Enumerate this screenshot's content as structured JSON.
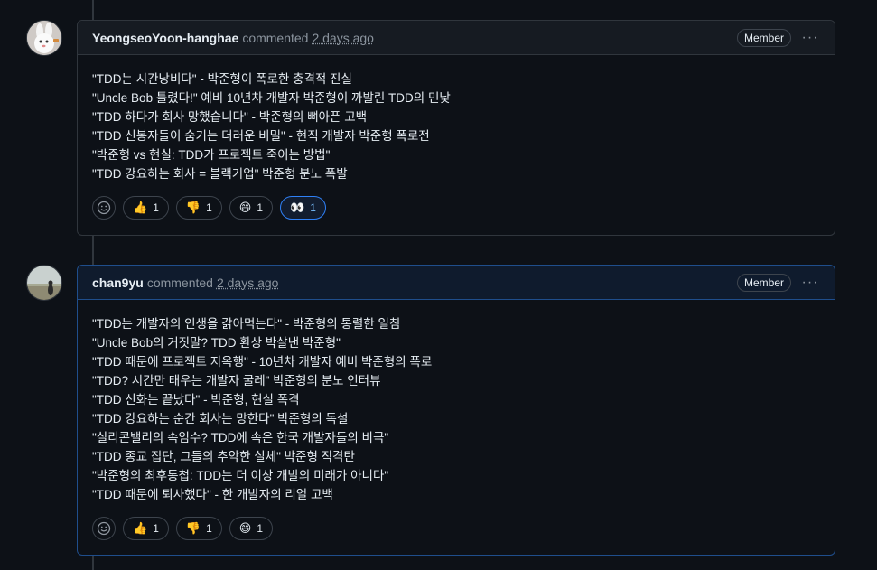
{
  "comments": [
    {
      "author": "YeongseoYoon-hanghae",
      "verb": "commented",
      "time": "2 days ago",
      "badge": "Member",
      "lines": [
        "\"TDD는 시간낭비다\" - 박준형이 폭로한 충격적 진실",
        "\"Uncle Bob 틀렸다!\" 예비 10년차 개발자 박준형이 까발린 TDD의 민낯",
        "\"TDD 하다가 회사 망했습니다\" - 박준형의 뼈아픈 고백",
        "\"TDD 신봉자들이 숨기는 더러운 비밀\" - 현직 개발자 박준형 폭로전",
        "\"박준형 vs 현실: TDD가 프로젝트 죽이는 방법\"",
        "\"TDD 강요하는 회사 = 블랙기업\" 박준형 분노 폭발"
      ],
      "reactions": [
        {
          "icon": "thumbs-up-icon",
          "emoji": "👍",
          "count": "1"
        },
        {
          "icon": "thumbs-down-icon",
          "emoji": "👎",
          "count": "1"
        },
        {
          "icon": "laugh-icon",
          "emoji": "😄",
          "count": "1"
        },
        {
          "icon": "eyes-icon",
          "emoji": "👀",
          "count": "1"
        }
      ]
    },
    {
      "author": "chan9yu",
      "verb": "commented",
      "time": "2 days ago",
      "badge": "Member",
      "lines": [
        "\"TDD는 개발자의 인생을 갉아먹는다\" - 박준형의 통렬한 일침",
        "\"Uncle Bob의 거짓말? TDD 환상 박살낸 박준형\"",
        "\"TDD 때문에 프로젝트 지옥행\" - 10년차 개발자 예비 박준형의 폭로",
        "\"TDD? 시간만 태우는 개발자 굴레\" 박준형의 분노 인터뷰",
        "\"TDD 신화는 끝났다\" - 박준형, 현실 폭격",
        "\"TDD 강요하는 순간 회사는 망한다\" 박준형의 독설",
        "\"실리콘밸리의 속임수? TDD에 속은 한국 개발자들의 비극\"",
        "\"TDD 종교 집단, 그들의 추악한 실체\" 박준형 직격탄",
        "\"박준형의 최후통첩: TDD는 더 이상 개발의 미래가 아니다\"",
        "\"TDD 때문에 퇴사했다\" - 한 개발자의 리얼 고백"
      ],
      "reactions": [
        {
          "icon": "thumbs-up-icon",
          "emoji": "👍",
          "count": "1"
        },
        {
          "icon": "thumbs-down-icon",
          "emoji": "👎",
          "count": "1"
        },
        {
          "icon": "laugh-icon",
          "emoji": "😄",
          "count": "1"
        }
      ]
    }
  ],
  "kebab": "···",
  "colors": {
    "accent": "#2f81f7",
    "border": "#30363d",
    "bg": "#0d1117"
  }
}
